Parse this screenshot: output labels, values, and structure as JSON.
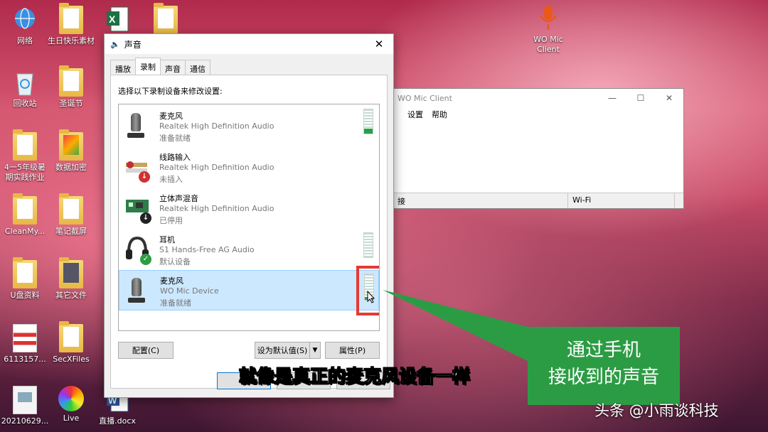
{
  "desktop": {
    "icons": [
      {
        "label": "网络",
        "icon": "network-icon"
      },
      {
        "label": "生日快乐素材",
        "icon": "folder-icon"
      },
      {
        "label": "回收站",
        "icon": "recycle-bin-icon"
      },
      {
        "label": "圣诞节",
        "icon": "folder-icon"
      },
      {
        "label": "4一5年级暑期实践作业",
        "icon": "folder-icon"
      },
      {
        "label": "数据加密",
        "icon": "folder-icon"
      },
      {
        "label": "CleanMy...",
        "icon": "folder-icon"
      },
      {
        "label": "笔记截屏",
        "icon": "folder-icon"
      },
      {
        "label": "U盘资料",
        "icon": "folder-icon"
      },
      {
        "label": "其它文件",
        "icon": "folder-icon"
      },
      {
        "label": "6113157...",
        "icon": "image-file-icon"
      },
      {
        "label": "SecXFiles",
        "icon": "folder-icon"
      },
      {
        "label": "20210629...",
        "icon": "image-file-icon"
      },
      {
        "label": "Live",
        "icon": "color-wheel-icon"
      },
      {
        "label": "直播.docx",
        "icon": "word-doc-icon"
      },
      {
        "label": "WO Mic Client",
        "icon": "microphone-icon"
      }
    ]
  },
  "sound_dialog": {
    "title": "声音",
    "tabs": [
      "播放",
      "录制",
      "声音",
      "通信"
    ],
    "active_tab": "录制",
    "hint": "选择以下录制设备来修改设置:",
    "devices": [
      {
        "name": "麦克风",
        "driver": "Realtek High Definition Audio",
        "status": "准备就绪",
        "icon": "microphone-icon",
        "level": 0.2
      },
      {
        "name": "线路输入",
        "driver": "Realtek High Definition Audio",
        "status": "未插入",
        "icon": "line-in-jack-icon",
        "badge": "down-arrow-badge"
      },
      {
        "name": "立体声混音",
        "driver": "Realtek High Definition Audio",
        "status": "已停用",
        "icon": "sound-card-icon",
        "badge": "down-arrow-badge"
      },
      {
        "name": "耳机",
        "driver": "S1 Hands-Free AG Audio",
        "status": "默认设备",
        "icon": "headset-icon",
        "badge": "check-badge",
        "level": 0
      },
      {
        "name": "麦克风",
        "driver": "WO Mic Device",
        "status": "准备就绪",
        "icon": "microphone-icon",
        "level": 0.1
      }
    ],
    "buttons": {
      "configure": "配置(C)",
      "set_default": "设为默认值(S)",
      "properties": "属性(P)"
    }
  },
  "wo_mic_window": {
    "title": "WO Mic Client",
    "menu": [
      "设置",
      "帮助"
    ],
    "status_left": "接",
    "status_right": "Wi-Fi"
  },
  "overlay": {
    "callout": [
      "通过手机",
      "接收到的声音"
    ],
    "subtitle": "就像是真正的麦克风设备一样",
    "watermark": "头条 @小雨谈科技"
  },
  "colors": {
    "accent_green": "#2c9c44",
    "highlight_red": "#e53935",
    "selection_blue": "#cce8ff"
  }
}
